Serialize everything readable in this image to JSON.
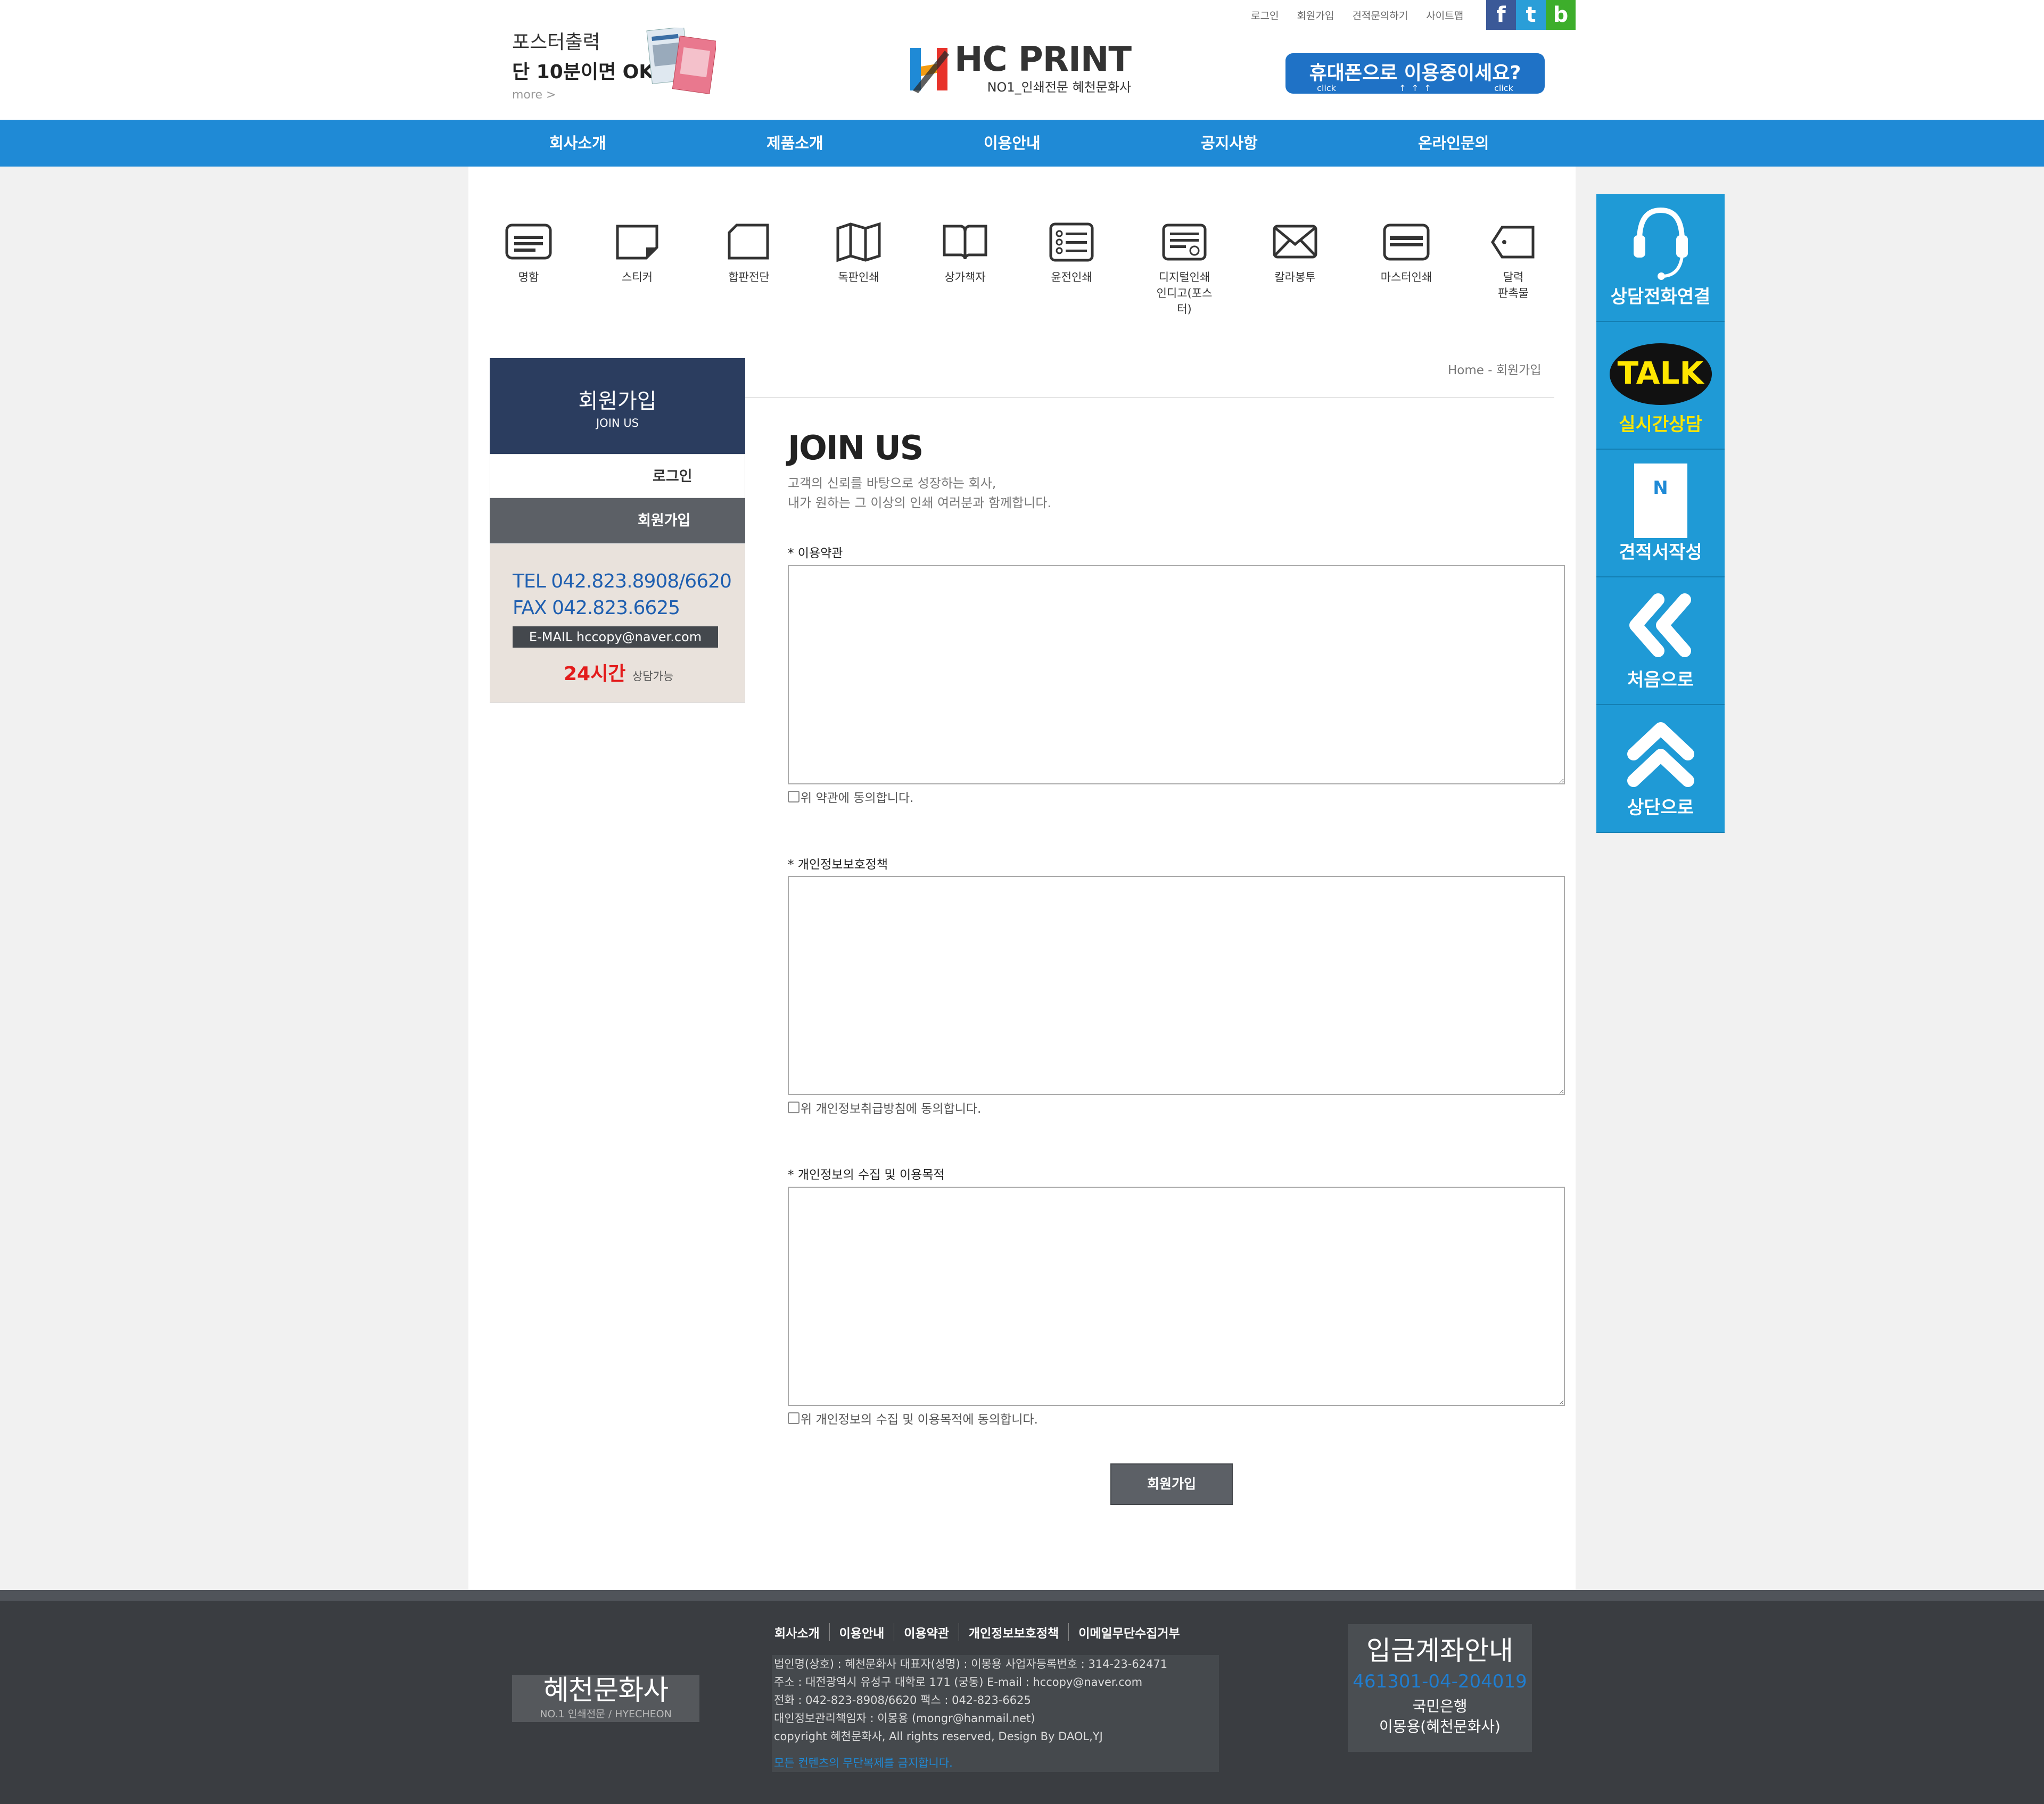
{
  "utility": [
    "로그인",
    "회원가입",
    "견적문의하기",
    "사이트맵"
  ],
  "social": [
    {
      "label": "f",
      "color": "#3b5998"
    },
    {
      "label": "t",
      "color": "#2a9ed8"
    },
    {
      "label": "b",
      "color": "#3dae2b"
    }
  ],
  "promo": {
    "line1": "포스터출력",
    "line2": "단 10분이면 OK!",
    "more": "more >"
  },
  "logo": {
    "name": "HC PRINT",
    "tagline": "NO1_인쇄전문 혜천문화사"
  },
  "mobile": {
    "text": "휴대폰으로 이용중이세요?",
    "click1": "click",
    "click2": "click"
  },
  "nav": [
    "회사소개",
    "제품소개",
    "이용안내",
    "공지사항",
    "온라인문의"
  ],
  "categories": [
    {
      "label": "명함",
      "icon": "card-icon"
    },
    {
      "label": "스티커",
      "icon": "sticker-icon"
    },
    {
      "label": "합판전단",
      "icon": "flyer-icon"
    },
    {
      "label": "독판인쇄",
      "icon": "map-icon"
    },
    {
      "label": "상가책자",
      "icon": "book-icon"
    },
    {
      "label": "윤전인쇄",
      "icon": "rotary-icon"
    },
    {
      "label": "디지털인쇄",
      "label2": "인디고(포스터)",
      "icon": "digital-print-icon"
    },
    {
      "label": "칼라봉투",
      "icon": "envelope-icon"
    },
    {
      "label": "마스터인쇄",
      "icon": "master-icon"
    },
    {
      "label": "달력",
      "label2": "판촉물",
      "icon": "tag-icon"
    }
  ],
  "sidebar": {
    "title": "회원가입",
    "subtitle": "JOIN US",
    "login": "로그인",
    "join": "회원가입",
    "tel": "TEL 042.823.8908/6620",
    "fax": "FAX 042.823.6625",
    "email": "E-MAIL hccopy@naver.com",
    "hours": "24시간",
    "hours_note": "상담가능"
  },
  "breadcrumb": "Home - 회원가입",
  "main": {
    "title": "JOIN US",
    "sub1": "고객의 신뢰를 바탕으로 성장하는 회사,",
    "sub2": "내가 원하는 그 이상의 인쇄 여러분과 함께합니다.",
    "sections": [
      {
        "label": "* 이용약관",
        "agree": "위 약관에 동의합니다."
      },
      {
        "label": "* 개인정보보호정책",
        "agree": "위 개인정보취급방침에 동의합니다."
      },
      {
        "label": "* 개인정보의 수집 및 이용목적",
        "agree": "위 개인정보의 수집 및 이용목적에 동의합니다."
      }
    ],
    "submit": "회원가입"
  },
  "floatbar": [
    {
      "label": "상담전화연결",
      "icon": "headset-icon"
    },
    {
      "label": "실시간상담",
      "icon": "talk-icon",
      "badge": "TALK"
    },
    {
      "label": "견적서작성",
      "icon": "quote-doc-icon",
      "badge": "N"
    },
    {
      "label": "처음으로",
      "icon": "double-left-icon"
    },
    {
      "label": "상단으로",
      "icon": "double-up-icon"
    }
  ],
  "footer": {
    "logo": "혜천문화사",
    "logo_sub": "NO.1 인쇄전문 / HYECHEON",
    "links": [
      "회사소개",
      "이용안내",
      "이용약관",
      "개인정보보호정책",
      "이메일무단수집거부"
    ],
    "info": [
      "법인명(상호) : 혜천문화사    대표자(성명) : 이몽용    사업자등록번호 : 314-23-62471",
      "주소 : 대전광역시 유성구 대학로 171 (궁동)         E-mail : hccopy@naver.com",
      "전화 : 042-823-8908/6620          팩스 : 042-823-6625",
      "대인정보관리책임자 : 이몽용 (mongr@hanmail.net)",
      "copyright 혜천문화사, All rights reserved, Design By DAOL,YJ"
    ],
    "notice": "모든 컨텐츠의 무단복제를 금지합니다.",
    "bank_title": "입금계좌안내",
    "bank_account": "461301-04-204019",
    "bank_name": "국민은행",
    "bank_holder": "이몽용(혜천문화사)"
  }
}
